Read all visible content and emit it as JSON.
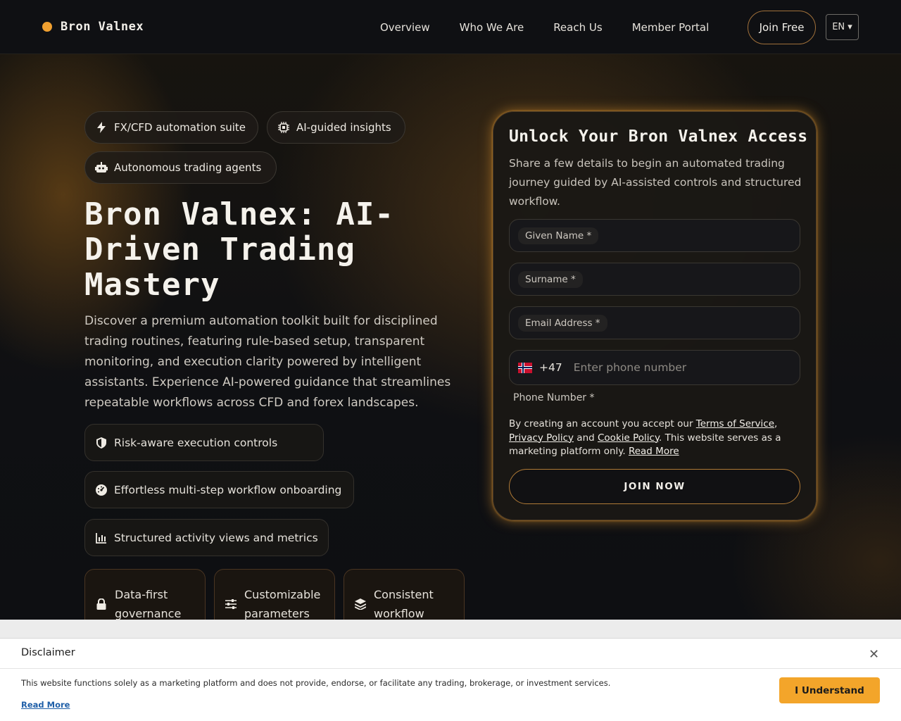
{
  "header": {
    "brand": "Bron Valnex",
    "nav": [
      "Overview",
      "Who We Are",
      "Reach Us",
      "Member Portal"
    ],
    "join_label": "Join Free",
    "lang_label": "EN ▾"
  },
  "hero": {
    "pills": [
      "FX/CFD automation suite",
      "AI-guided insights",
      "Autonomous trading agents"
    ],
    "title": "Bron Valnex: AI-Driven Trading Mastery",
    "description": "Discover a premium automation toolkit built for disciplined trading routines, featuring rule-based setup, transparent monitoring, and execution clarity powered by intelligent assistants. Experience AI-powered guidance that streamlines repeatable workflows across CFD and forex landscapes.",
    "features": [
      "Risk-aware execution controls",
      "Effortless multi-step workflow onboarding",
      "Structured activity views and metrics"
    ],
    "cards": [
      "Data-first governance",
      "Customizable parameters",
      "Consistent workflow"
    ]
  },
  "form": {
    "title": "Unlock Your Bron Valnex Access",
    "subtitle": "Share a few details to begin an automated trading journey guided by AI-assisted controls and structured workflow.",
    "given_name": "Given Name *",
    "surname": "Surname *",
    "email": "Email Address *",
    "dial_code": "+47",
    "phone_placeholder": "Enter phone number",
    "phone_label": "Phone Number *",
    "terms_prefix": "By creating an account you accept our ",
    "terms_link": "Terms of Service",
    "terms_comma": ",",
    "privacy_link": "Privacy Policy",
    "terms_and": " and ",
    "cookie_link": "Cookie Policy",
    "terms_suffix": ". This website serves as a marketing platform only. ",
    "read_more": "Read More",
    "submit": "JOIN NOW"
  },
  "disclaimer": {
    "title": "Disclaimer",
    "close": "✕",
    "text": "This website functions solely as a marketing platform and does not provide, endorse, or facilitate any trading, brokerage, or investment services.",
    "read_more": "Read More",
    "button": "I Understand"
  },
  "colors": {
    "accent": "#f0a030",
    "button_amber": "#f3a52a",
    "background": "#0d0e11"
  }
}
